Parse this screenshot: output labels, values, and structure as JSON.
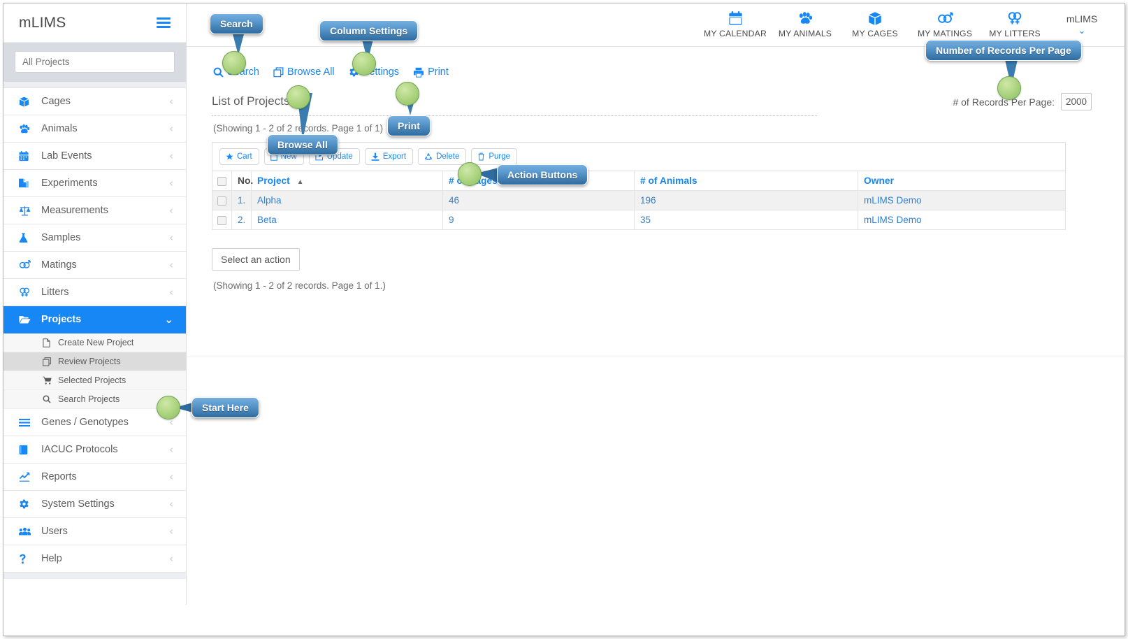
{
  "brand": {
    "name": "mLIMS",
    "menu_icon": "hamburger-icon"
  },
  "sidebar": {
    "search_placeholder": "All Projects",
    "items": [
      {
        "label": "Cages",
        "icon": "box-icon"
      },
      {
        "label": "Animals",
        "icon": "paw-icon"
      },
      {
        "label": "Lab Events",
        "icon": "calendar-icon"
      },
      {
        "label": "Experiments",
        "icon": "flask-doc-icon"
      },
      {
        "label": "Measurements",
        "icon": "scale-icon"
      },
      {
        "label": "Samples",
        "icon": "flask-icon"
      },
      {
        "label": "Matings",
        "icon": "mars-venus-icon"
      },
      {
        "label": "Litters",
        "icon": "venus-double-icon"
      },
      {
        "label": "Projects",
        "icon": "folder-open-icon",
        "active": true
      },
      {
        "label": "Genes / Genotypes",
        "icon": "bars-icon"
      },
      {
        "label": "IACUC Protocols",
        "icon": "book-icon"
      },
      {
        "label": "Reports",
        "icon": "chart-line-icon"
      },
      {
        "label": "System Settings",
        "icon": "gear-icon"
      },
      {
        "label": "Users",
        "icon": "users-icon"
      },
      {
        "label": "Help",
        "icon": "question-icon"
      }
    ],
    "projects_subitems": [
      {
        "label": "Create New Project",
        "icon": "file-icon"
      },
      {
        "label": "Review Projects",
        "icon": "copy-icon",
        "selected": true
      },
      {
        "label": "Selected Projects",
        "icon": "cart-icon"
      },
      {
        "label": "Search Projects",
        "icon": "search-icon"
      }
    ]
  },
  "topnav": {
    "items": [
      {
        "label": "MY CALENDAR",
        "icon": "calendar-icon"
      },
      {
        "label": "MY ANIMALS",
        "icon": "paw-icon"
      },
      {
        "label": "MY CAGES",
        "icon": "box-icon"
      },
      {
        "label": "MY MATINGS",
        "icon": "mars-venus-icon"
      },
      {
        "label": "MY LITTERS",
        "icon": "venus-double-icon"
      }
    ],
    "user": {
      "name": "mLIMS",
      "caret": "chevron-down-icon"
    }
  },
  "toolbar": {
    "search": "Search",
    "browse_all": "Browse All",
    "settings": "Settings",
    "print": "Print"
  },
  "records_per_page": {
    "label": "# of Records Per Page:",
    "value": "2000"
  },
  "page": {
    "title": "List of Projects",
    "showing_top": "(Showing 1 - 2 of 2 records. Page 1 of 1)",
    "showing_bottom_prefix": "(Showing ",
    "showing_bottom": "(Showing 1 - 2 of 2 records. Page 1 of 1.)",
    "select_action": "Select an action"
  },
  "action_buttons": [
    {
      "label": "Cart",
      "icon": "star-icon"
    },
    {
      "label": "New",
      "icon": "file-icon"
    },
    {
      "label": "Update",
      "icon": "pencil-square-icon"
    },
    {
      "label": "Export",
      "icon": "download-icon"
    },
    {
      "label": "Delete",
      "icon": "recycle-icon"
    },
    {
      "label": "Purge",
      "icon": "trash-icon"
    }
  ],
  "table": {
    "columns": [
      "",
      "No.",
      "Project",
      "# of Cages",
      "# of Animals",
      "Owner"
    ],
    "sorted_column": "Project",
    "sort_direction": "asc",
    "rows": [
      {
        "no": "1.",
        "project": "Alpha",
        "cages": "46",
        "animals": "196",
        "owner": "mLIMS Demo"
      },
      {
        "no": "2.",
        "project": "Beta",
        "cages": "9",
        "animals": "35",
        "owner": "mLIMS Demo"
      }
    ]
  },
  "callouts": [
    {
      "id": "search",
      "label": "Search"
    },
    {
      "id": "column_settings",
      "label": "Column Settings"
    },
    {
      "id": "browse_all",
      "label": "Browse All"
    },
    {
      "id": "print",
      "label": "Print"
    },
    {
      "id": "records_per_page",
      "label": "Number of  Records Per Page"
    },
    {
      "id": "action_buttons",
      "label": "Action Buttons"
    },
    {
      "id": "start_here",
      "label": "Start Here"
    }
  ],
  "colors": {
    "accent": "#1787f5",
    "link": "#2d7fd6",
    "sidebar_search_bg": "#d9dbe3",
    "callout_bubble": "#2f6b9e",
    "callout_dot": "#aad27d"
  }
}
